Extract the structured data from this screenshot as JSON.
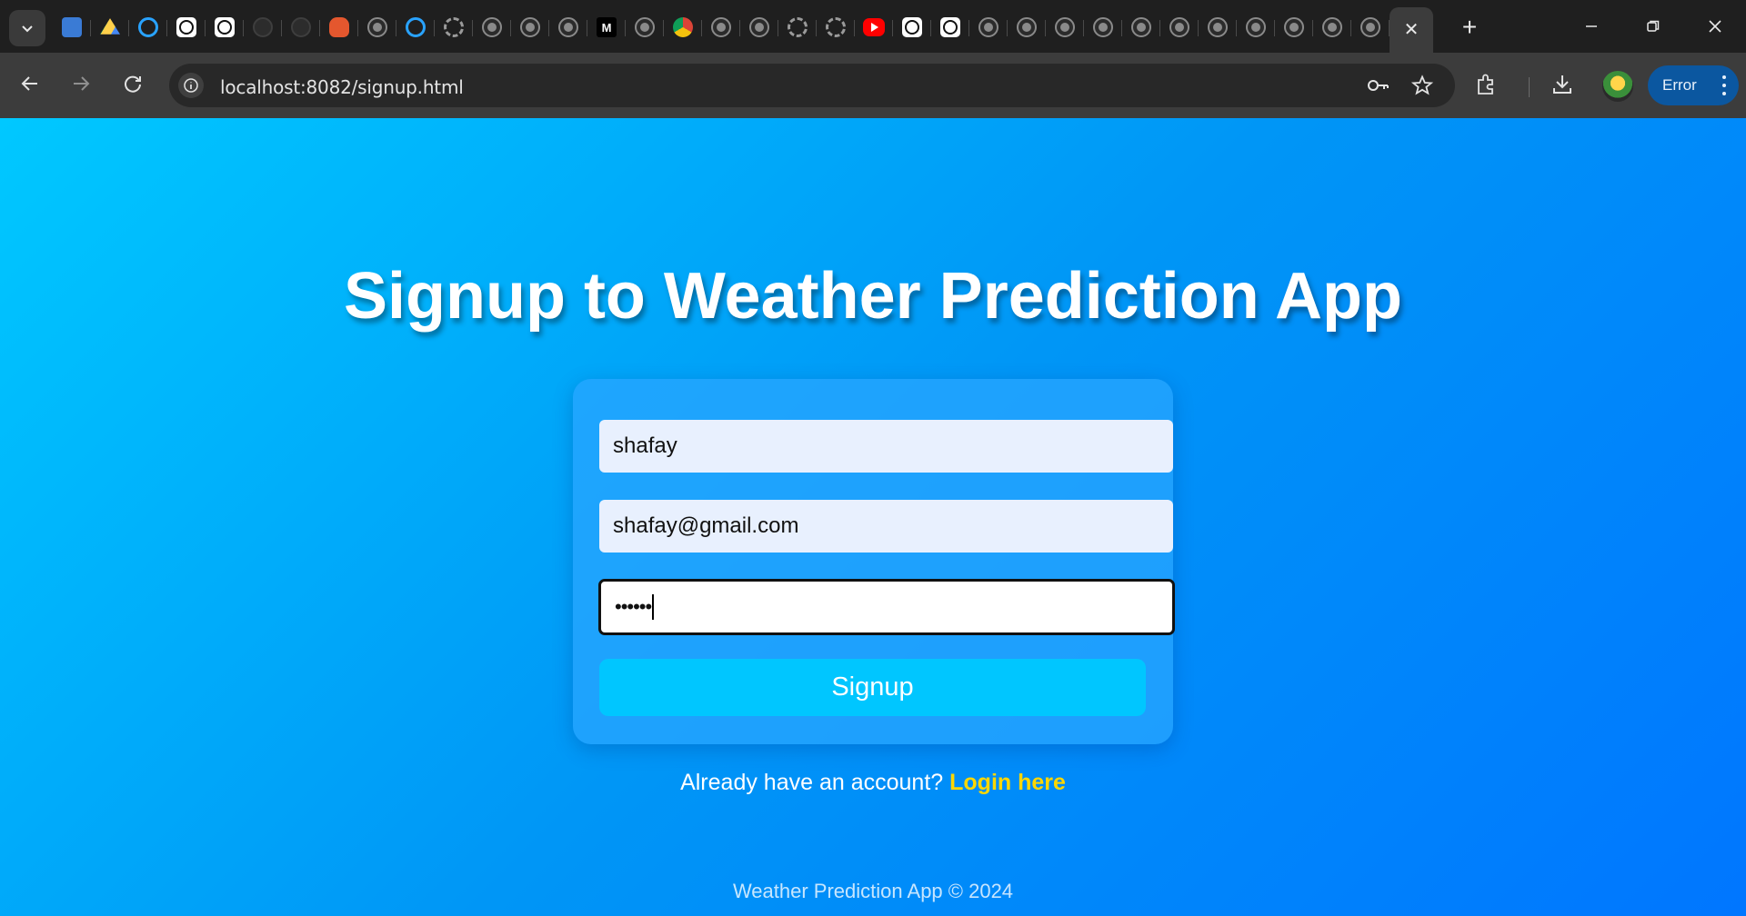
{
  "browser": {
    "tab_icons": [
      "contacts-icon",
      "drive-icon",
      "ring-icon",
      "openai-icon",
      "openai-icon",
      "github-icon",
      "github-icon",
      "orange-app-icon",
      "globe-icon",
      "ring-icon",
      "ring-gray-icon",
      "globe-icon",
      "globe-icon",
      "globe-icon",
      "medium-icon",
      "globe-icon",
      "chrome-icon",
      "globe-icon",
      "globe-icon",
      "ring-gray-icon",
      "ring-gray-icon",
      "youtube-icon",
      "openai-icon",
      "openai-icon",
      "globe-icon",
      "globe-icon",
      "globe-icon",
      "globe-icon",
      "globe-icon",
      "globe-icon",
      "globe-icon",
      "globe-icon",
      "globe-icon",
      "globe-icon",
      "globe-icon"
    ],
    "active_tab_close": "✕",
    "new_tab": "+",
    "url": "localhost:8082/signup.html",
    "profile_error_label": "Error"
  },
  "page": {
    "title": "Signup to Weather Prediction App",
    "form": {
      "username_value": "shafay",
      "email_value": "shafay@gmail.com",
      "password_mask": "••••••",
      "submit_label": "Signup"
    },
    "login_prompt": "Already have an account?",
    "login_link": "Login here",
    "footer": "Weather Prediction App © 2024"
  },
  "colors": {
    "gradient_start": "#00c8ff",
    "gradient_end": "#0076ff",
    "button": "#00c6ff",
    "link": "#ffd700"
  }
}
